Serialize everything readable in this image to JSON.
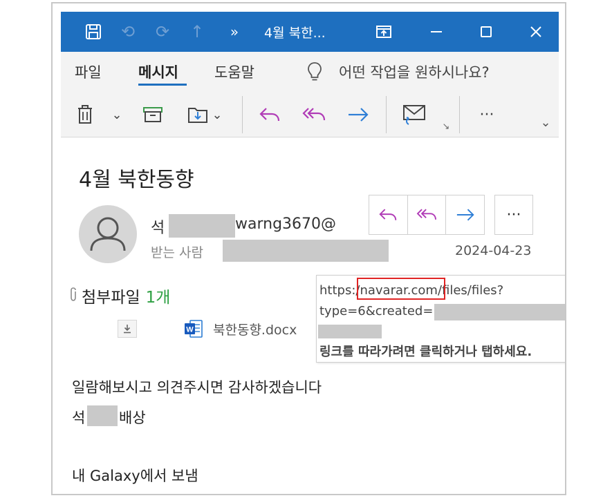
{
  "titlebar": {
    "title": "4월 북한...",
    "overflow": "»",
    "icons": [
      "save-icon",
      "undo-icon",
      "redo-icon",
      "up-arrow-icon",
      "popout-icon",
      "minimize-icon",
      "maximize-icon",
      "close-icon"
    ]
  },
  "menu": {
    "tabs": [
      "파일",
      "메시지",
      "도움말"
    ],
    "active_tab": "메시지",
    "tell_me": "어떤 작업을 원하시나요?"
  },
  "ribbon": {
    "buttons": [
      "delete",
      "archive",
      "move",
      "reply",
      "reply-all",
      "forward",
      "report-message",
      "more"
    ],
    "dropdown_caret": "⌄",
    "more": "···"
  },
  "message": {
    "subject": "4월 북한동향",
    "sender_prefix": "석",
    "sender_suffix": "warng3670@",
    "to_label": "받는 사람",
    "date": "2024-04-23",
    "more": "···",
    "attachment": {
      "label": "첨부파일",
      "count": "1개",
      "filename": "북한동향.docx"
    },
    "body": {
      "line1": "일람해보시고 의견주시면 감사하겠습니다",
      "sign_prefix": "석",
      "sign_suffix": "배상",
      "footer": "내 Galaxy에서 보냄"
    }
  },
  "tooltip": {
    "url_prefix": "https:",
    "url_domain": "/navarar.com",
    "url_path": "/files/files?",
    "url_line2": "type=6&created=",
    "instruction": "링크를 따라가려면 클릭하거나 탭하세요."
  },
  "colors": {
    "titlebar": "#1e6fbf",
    "reply_accent": "#b03bb6",
    "forward_accent": "#2f7fd6",
    "attachment_count": "#2ea043",
    "highlight_box": "#e02424",
    "redaction": "#c9c9c9"
  }
}
